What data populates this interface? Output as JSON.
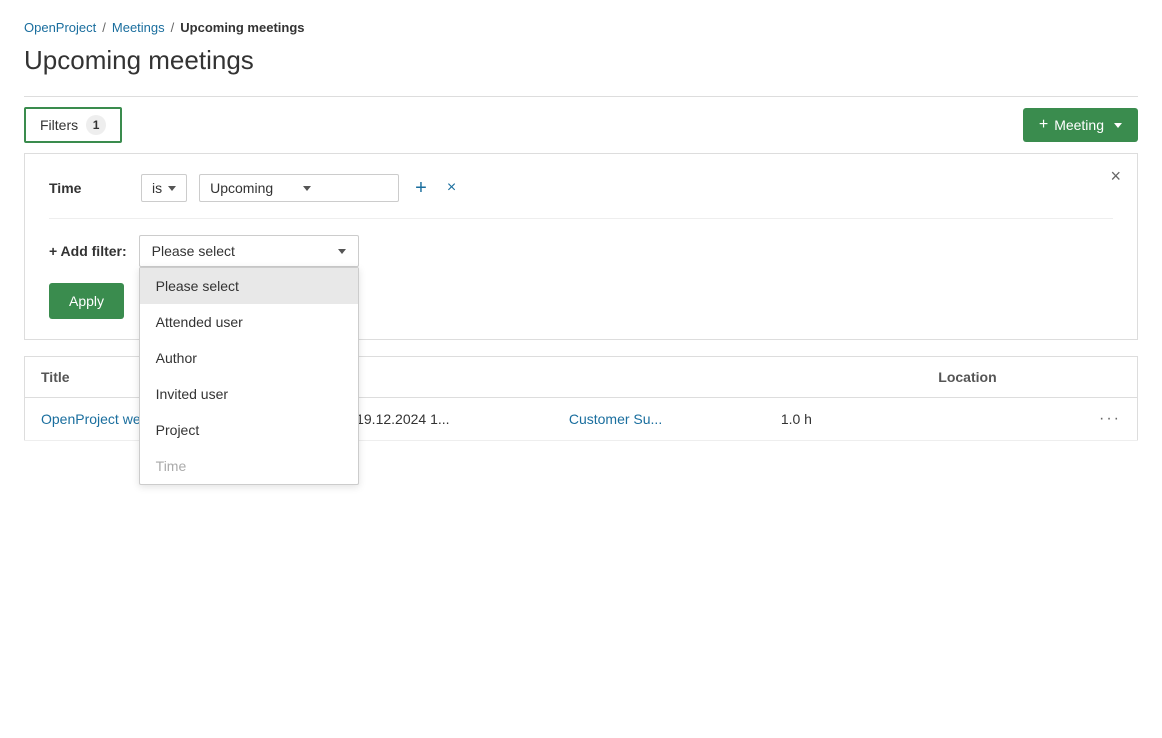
{
  "breadcrumb": {
    "openproject": "OpenProject",
    "meetings": "Meetings",
    "separator": "/",
    "current": "Upcoming meetings"
  },
  "page": {
    "title": "Upcoming meetings"
  },
  "toolbar": {
    "filters_label": "Filters",
    "filters_count": "1",
    "new_meeting_label": "Meeting",
    "new_meeting_plus": "+"
  },
  "filter_panel": {
    "close_label": "×",
    "filter_row": {
      "label": "Time",
      "operator": "is",
      "value": "Upcoming",
      "add_icon": "+",
      "remove_icon": "×"
    },
    "add_filter": {
      "label": "+ Add filter:",
      "placeholder": "Please select"
    },
    "apply_label": "Apply"
  },
  "dropdown": {
    "options": [
      {
        "value": "please_select",
        "label": "Please select",
        "state": "selected"
      },
      {
        "value": "attended_user",
        "label": "Attended user",
        "state": "normal"
      },
      {
        "value": "author",
        "label": "Author",
        "state": "normal"
      },
      {
        "value": "invited_user",
        "label": "Invited user",
        "state": "normal"
      },
      {
        "value": "project",
        "label": "Project",
        "state": "normal"
      },
      {
        "value": "time",
        "label": "Time",
        "state": "disabled"
      }
    ]
  },
  "table": {
    "columns": [
      {
        "id": "title",
        "label": "Title"
      },
      {
        "id": "date",
        "label": ""
      },
      {
        "id": "project",
        "label": ""
      },
      {
        "id": "duration",
        "label": ""
      },
      {
        "id": "location",
        "label": "Location"
      }
    ],
    "rows": [
      {
        "title": "OpenProject weekly",
        "title_link": true,
        "date": "19.12.2024 1...",
        "project": "Customer Su...",
        "project_link": true,
        "duration": "1.0 h",
        "location": "",
        "actions": "···"
      }
    ]
  }
}
